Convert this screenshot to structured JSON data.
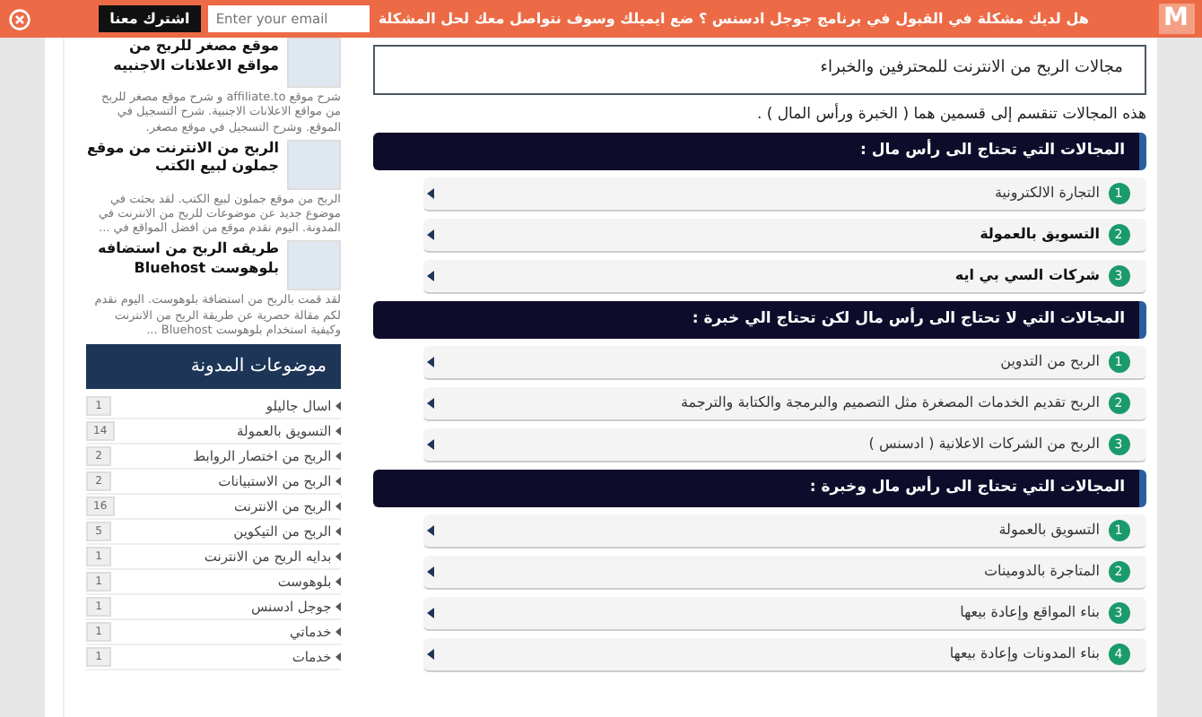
{
  "top_bar": {
    "logo": "M",
    "message": "هل لديك مشكلة في القبول في برنامج جوجل ادسنس ؟ ضع ايميلك وسوف نتواصل معك لحل المشكلة",
    "email_placeholder": "Enter your email",
    "subscribe_button": "اشترك معنا"
  },
  "sidebar": {
    "posts": [
      {
        "title": "موقع مصغر للربح من مواقع الاعلانات الاجنبيه",
        "excerpt": "شرح موقع affiliate.to و شرح موقع مصغر للربح من مواقع الاعلانات الاجنبية. شرح التسجيل في الموقع. وشرح التسجيل في موقع مصغر."
      },
      {
        "title": "الربح من الانترنت من موقع جملون لبيع الكتب",
        "excerpt": "الربح من موقع جملون لبيع الكتب. لقد بحثت في موضوع جديد عن موضوعات للربح من الانترنت في المدونة. اليوم نقدم موقع من افضل المواقع في ..."
      },
      {
        "title": "طريقه الربح من استضافه بلوهوست Bluehost",
        "excerpt": "لقد قمت بالربح من استضافة بلوهوست. اليوم نقدم لكم مقالة حصرية عن طريقة الربح من الانترنت وكيفية استخدام بلوهوست Bluehost ..."
      }
    ],
    "categories_title": "موضوعات المدونة",
    "categories": [
      {
        "label": "اسال جاليلو",
        "count": "1"
      },
      {
        "label": "التسويق بالعمولة",
        "count": "14"
      },
      {
        "label": "الربح من اختصار الروابط",
        "count": "2"
      },
      {
        "label": "الربح من الاستبيانات",
        "count": "2"
      },
      {
        "label": "الربح من الانترنت",
        "count": "16"
      },
      {
        "label": "الربح من التيكوين",
        "count": "5"
      },
      {
        "label": "بدايه الربح من الانترنت",
        "count": "1"
      },
      {
        "label": "بلوهوست",
        "count": "1"
      },
      {
        "label": "جوجل ادسنس",
        "count": "1"
      },
      {
        "label": "خدماتي",
        "count": "1"
      },
      {
        "label": "خدمات",
        "count": "1"
      }
    ]
  },
  "article": {
    "title": "مجالات الربح من الانترنت للمحترفين والخبراء",
    "intro": "هذه المجالات تنقسم إلى  قسمين  هما ( الخبرة ورأس  المال ) .",
    "sections": [
      {
        "heading": "المجالات التي تحتاج الى  رأس  مال :",
        "items": [
          {
            "number": "1",
            "label": "التجارة الالكترونية",
            "bold": false
          },
          {
            "number": "2",
            "label": "التسويق بالعمولة",
            "bold": true
          },
          {
            "number": "3",
            "label": "شركات السي بي ايه",
            "bold": true
          }
        ]
      },
      {
        "heading": "المجالات التي لا تحتاج الى  رأس  مال لكن تحتاج الي خبرة :",
        "items": [
          {
            "number": "1",
            "label": "الربح من التدوين",
            "bold": false
          },
          {
            "number": "2",
            "label": "الربح تقديم الخدمات المصغرة مثل التصميم والبرمجة والكتابة والترجمة",
            "bold": false
          },
          {
            "number": "3",
            "label": "الربح من الشركات الاعلانية ( ادسنس )",
            "bold": false
          }
        ]
      },
      {
        "heading": "المجالات التي تحتاج الى  رأس  مال وخبرة :",
        "items": [
          {
            "number": "1",
            "label": "التسويق بالعمولة",
            "bold": false
          },
          {
            "number": "2",
            "label": "المتاجرة بالدومينات",
            "bold": false
          },
          {
            "number": "3",
            "label": "بناء المواقع وإعادة  بيعها",
            "bold": false
          },
          {
            "number": "4",
            "label": "بناء المدونات وإعادة  بيعها",
            "bold": false
          }
        ]
      }
    ]
  }
}
